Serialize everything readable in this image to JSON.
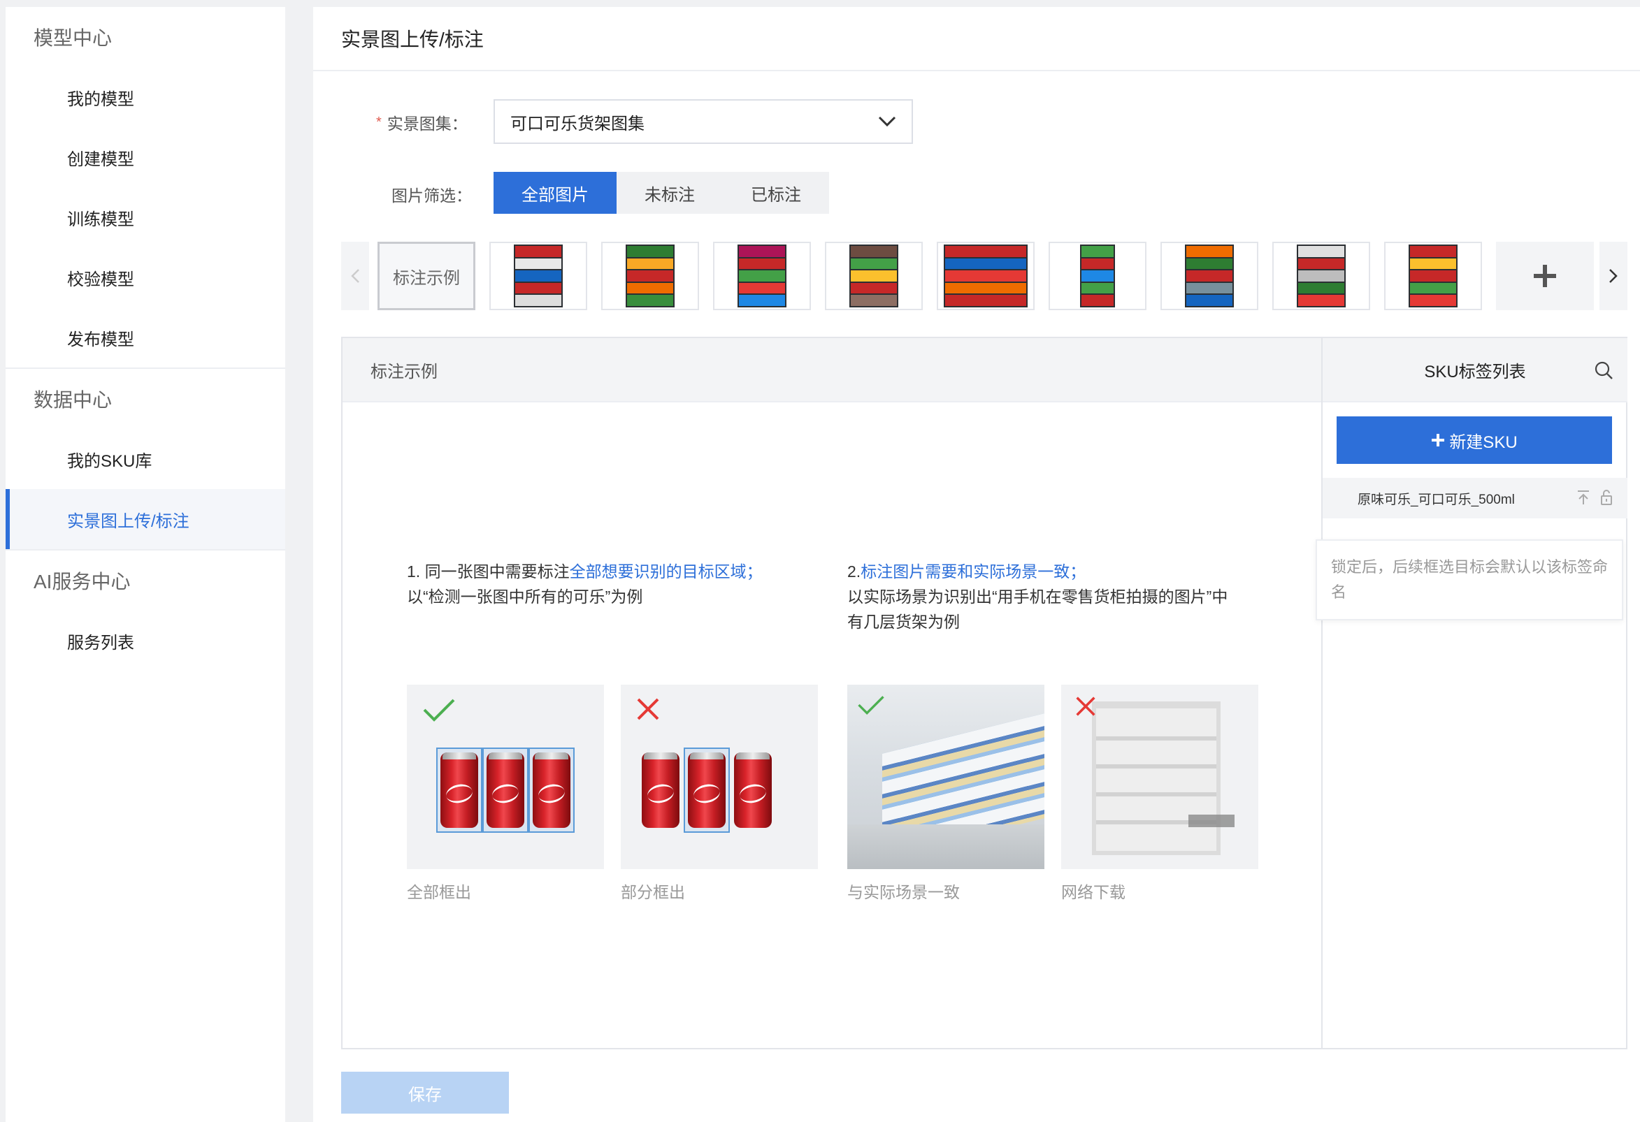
{
  "sidebar": {
    "sections": [
      {
        "title": "模型中心",
        "items": [
          "我的模型",
          "创建模型",
          "训练模型",
          "校验模型",
          "发布模型"
        ]
      },
      {
        "title": "数据中心",
        "items": [
          "我的SKU库",
          "实景图上传/标注"
        ]
      },
      {
        "title": "AI服务中心",
        "items": [
          "服务列表"
        ]
      }
    ],
    "active_item": "实景图上传/标注"
  },
  "main": {
    "page_title": "实景图上传/标注",
    "dataset_label": "实景图集：",
    "dataset_required_mark": "*",
    "dataset_value": "可口可乐货架图集",
    "filter_label": "图片筛选：",
    "filters": [
      "全部图片",
      "未标注",
      "已标注"
    ],
    "active_filter": "全部图片",
    "thumb_example_label": "标注示例",
    "content_title": "标注示例",
    "tip1_line1_plain": "1. 同一张图中需要标注",
    "tip1_line1_highlight": "全部想要识别的目标区域；",
    "tip1_line2": "以“检测一张图中所有的可乐”为例",
    "tip2_prefix": "2.",
    "tip2_highlight": "标注图片需要和实际场景一致；",
    "tip2_line2": "以实际场景为识别出“用手机在零售货柜拍摄的图片”中",
    "tip2_line3": "有几层货架为例",
    "examples": [
      {
        "caption": "全部框出",
        "mark": "✓"
      },
      {
        "caption": "部分框出",
        "mark": "✕"
      },
      {
        "caption": "与实际场景一致",
        "mark": "✓"
      },
      {
        "caption": "网络下载",
        "mark": "✕"
      }
    ],
    "save_label": "保存"
  },
  "sku_panel": {
    "title": "SKU标签列表",
    "new_button": "新建SKU",
    "items": [
      "原味可乐_可口可乐_500ml"
    ],
    "tooltip": "锁定后，后续框选目标会默认以该标签命名"
  },
  "colors": {
    "accent": "#2d6fd9",
    "check": "#4caf50",
    "cross": "#e53935"
  }
}
